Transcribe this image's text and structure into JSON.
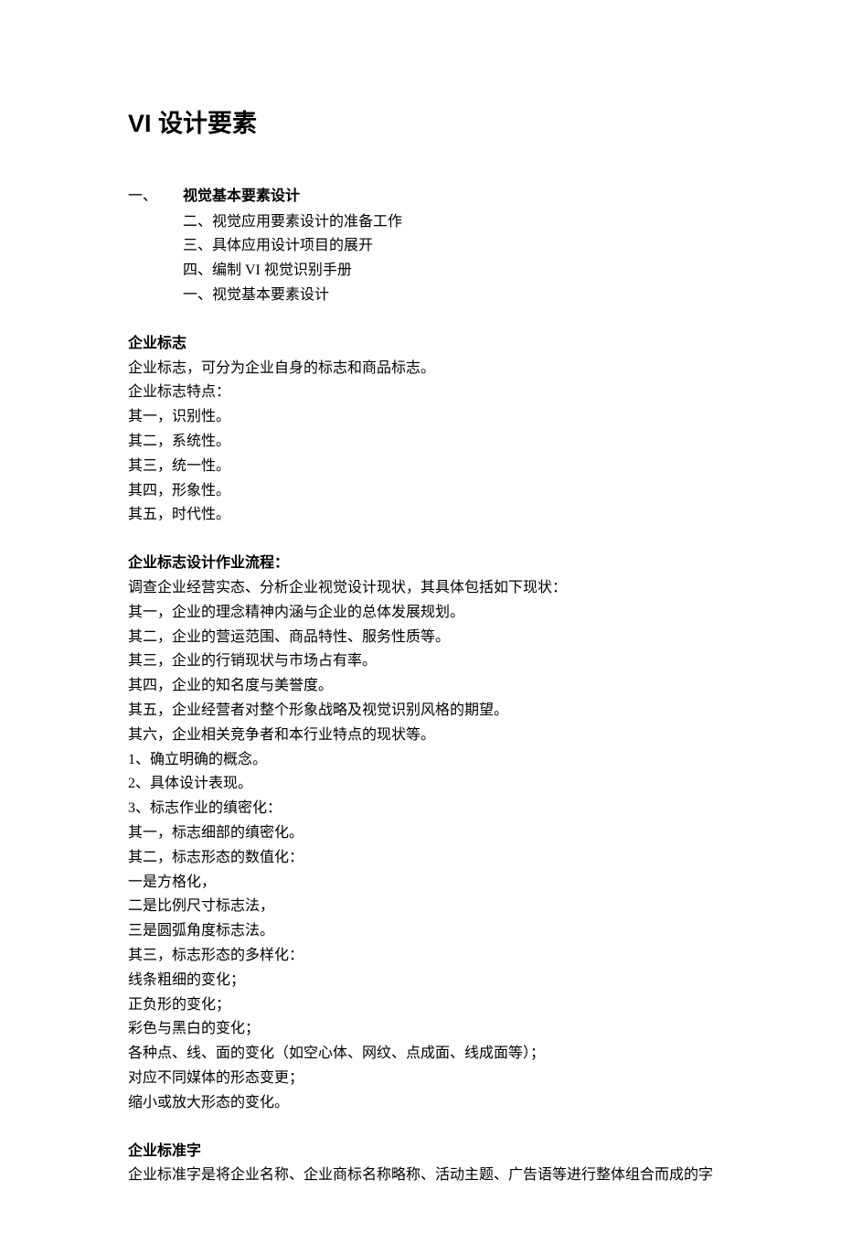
{
  "title": "VI 设计要素",
  "section1": {
    "number": "一、",
    "heading": "视觉基本要素设计",
    "outline": [
      "二、视觉应用要素设计的准备工作",
      "三、具体应用设计项目的展开",
      "四、编制 VI 视觉识别手册",
      "一、视觉基本要素设计"
    ]
  },
  "s_logo": {
    "heading": "企业标志",
    "lines": [
      "企业标志，可分为企业自身的标志和商品标志。",
      "企业标志特点：",
      "其一，识别性。",
      "其二，系统性。",
      "其三，统一性。",
      "其四，形象性。",
      "其五，时代性。"
    ]
  },
  "s_process": {
    "heading": "企业标志设计作业流程：",
    "lines": [
      "调查企业经营实态、分析企业视觉设计现状，其具体包括如下现状：",
      "其一，企业的理念精神内涵与企业的总体发展规划。",
      "其二，企业的营运范围、商品特性、服务性质等。",
      "其三，企业的行销现状与市场占有率。",
      "其四，企业的知名度与美誉度。",
      "其五，企业经营者对整个形象战略及视觉识别风格的期望。",
      "其六，企业相关竞争者和本行业特点的现状等。",
      "1、确立明确的概念。",
      "2、具体设计表现。",
      "3、标志作业的缜密化：",
      "其一，标志细部的缜密化。",
      "其二，标志形态的数值化：",
      "一是方格化，",
      "二是比例尺寸标志法，",
      "三是圆弧角度标志法。",
      "其三，标志形态的多样化：",
      "线条粗细的变化；",
      "正负形的变化；",
      "彩色与黑白的变化；",
      "各种点、线、面的变化（如空心体、网纹、点成面、线成面等）；",
      "对应不同媒体的形态变更；",
      "缩小或放大形态的变化。"
    ]
  },
  "s_font": {
    "heading": "企业标准字",
    "lines": [
      "企业标准字是将企业名称、企业商标名称略称、活动主题、广告语等进行整体组合而成的字"
    ]
  }
}
